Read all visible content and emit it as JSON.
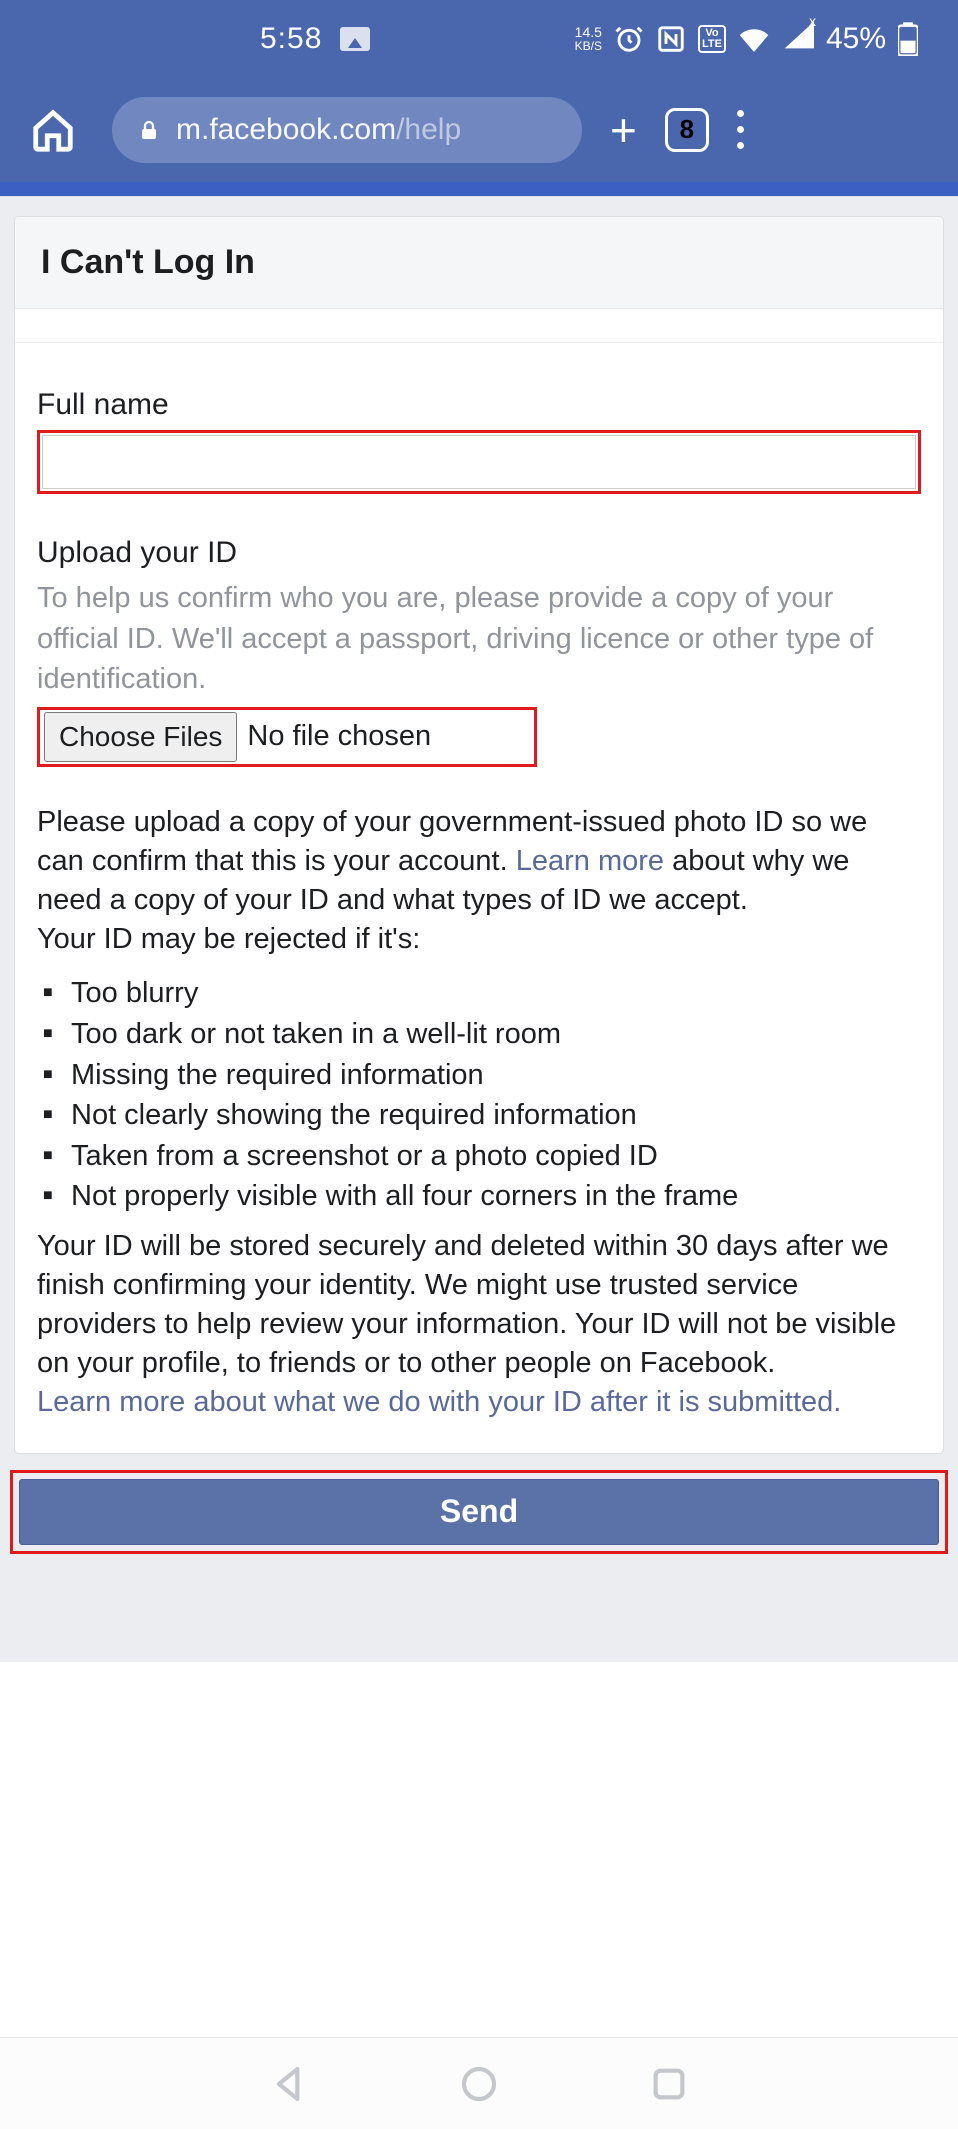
{
  "status": {
    "time": "5:58",
    "kbps_value": "14.5",
    "kbps_label": "KB/S",
    "lte_top": "Vo",
    "lte_bot": "LTE",
    "signal_x": "x",
    "battery_pct": "45%"
  },
  "browser": {
    "url_domain": "m.facebook.com",
    "url_path": "/help",
    "tab_count": "8"
  },
  "page": {
    "title": "I Can't Log In",
    "full_name_label": "Full name",
    "upload_label": "Upload your ID",
    "upload_helper": "To help us confirm who you are, please provide a copy of your official ID. We'll accept a passport, driving licence or other type of identification.",
    "choose_files_btn": "Choose Files",
    "no_file_text": "No file chosen",
    "para1_a": "Please upload a copy of your government-issued photo ID so we can confirm that this is your account. ",
    "learn_more": "Learn more",
    "para1_b": " about why we need a copy of your ID and what types of ID we accept.",
    "reject_intro": "Your ID may be rejected if it's:",
    "reject_list": [
      "Too blurry",
      "Too dark or not taken in a well-lit room",
      "Missing the required information",
      "Not clearly showing the required information",
      "Taken from a screenshot or a photo copied ID",
      "Not properly visible with all four corners in the frame"
    ],
    "storage_para": "Your ID will be stored securely and deleted within 30 days after we finish confirming your identity. We might use trusted service providers to help review your information. Your ID will not be visible on your profile, to friends or to other people on Facebook.",
    "learn_more_2": "Learn more about what we do with your ID after it is submitted.",
    "send_btn": "Send"
  }
}
